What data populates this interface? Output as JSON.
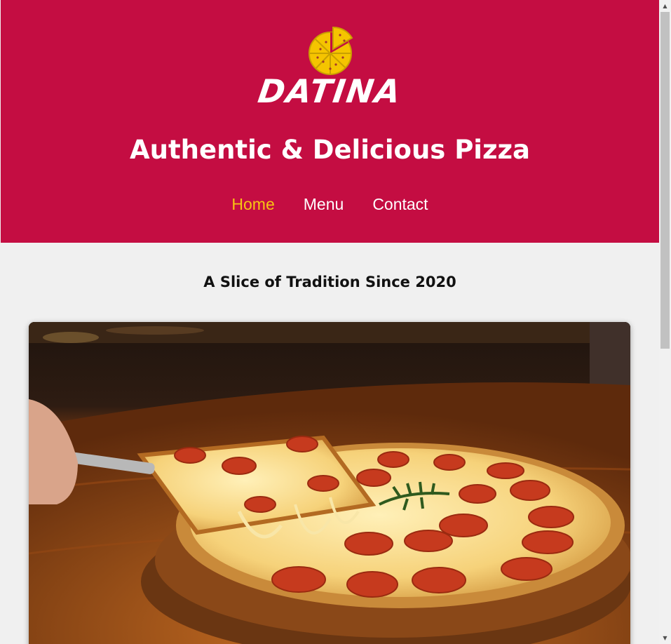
{
  "header": {
    "brand": "DATINA",
    "logo_icon": "pizza-icon",
    "tagline": "Authentic & Delicious Pizza",
    "background_color": "#c40d42",
    "active_nav_color": "#f7c413"
  },
  "nav": {
    "items": [
      {
        "label": "Home",
        "active": true
      },
      {
        "label": "Menu",
        "active": false
      },
      {
        "label": "Contact",
        "active": false
      }
    ]
  },
  "main": {
    "section_title": "A Slice of Tradition Since 2020",
    "hero_image_alt": "pizza-photo"
  },
  "scrollbar": {
    "up_icon": "scroll-up-arrow-icon",
    "down_icon": "scroll-down-arrow-icon"
  }
}
